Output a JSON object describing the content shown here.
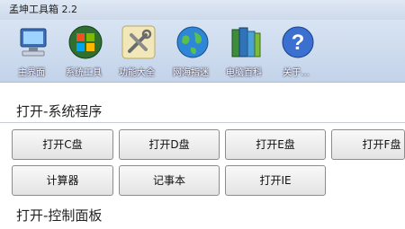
{
  "window": {
    "title": "孟坤工具箱 2.2"
  },
  "toolbar": {
    "items": [
      {
        "label": "主界面",
        "icon": "computer-icon"
      },
      {
        "label": "系统工具",
        "icon": "windows-logo-icon"
      },
      {
        "label": "功能大全",
        "icon": "tools-icon"
      },
      {
        "label": "网海指迷",
        "icon": "globe-icon"
      },
      {
        "label": "电脑百科",
        "icon": "books-icon"
      },
      {
        "label": "关于...",
        "icon": "help-icon"
      }
    ]
  },
  "main": {
    "section1_title": "打开-系统程序",
    "buttons": [
      "打开C盘",
      "打开D盘",
      "打开E盘",
      "打开F盘",
      "计算器",
      "记事本",
      "打开IE"
    ],
    "section2_title": "打开-控制面板"
  }
}
